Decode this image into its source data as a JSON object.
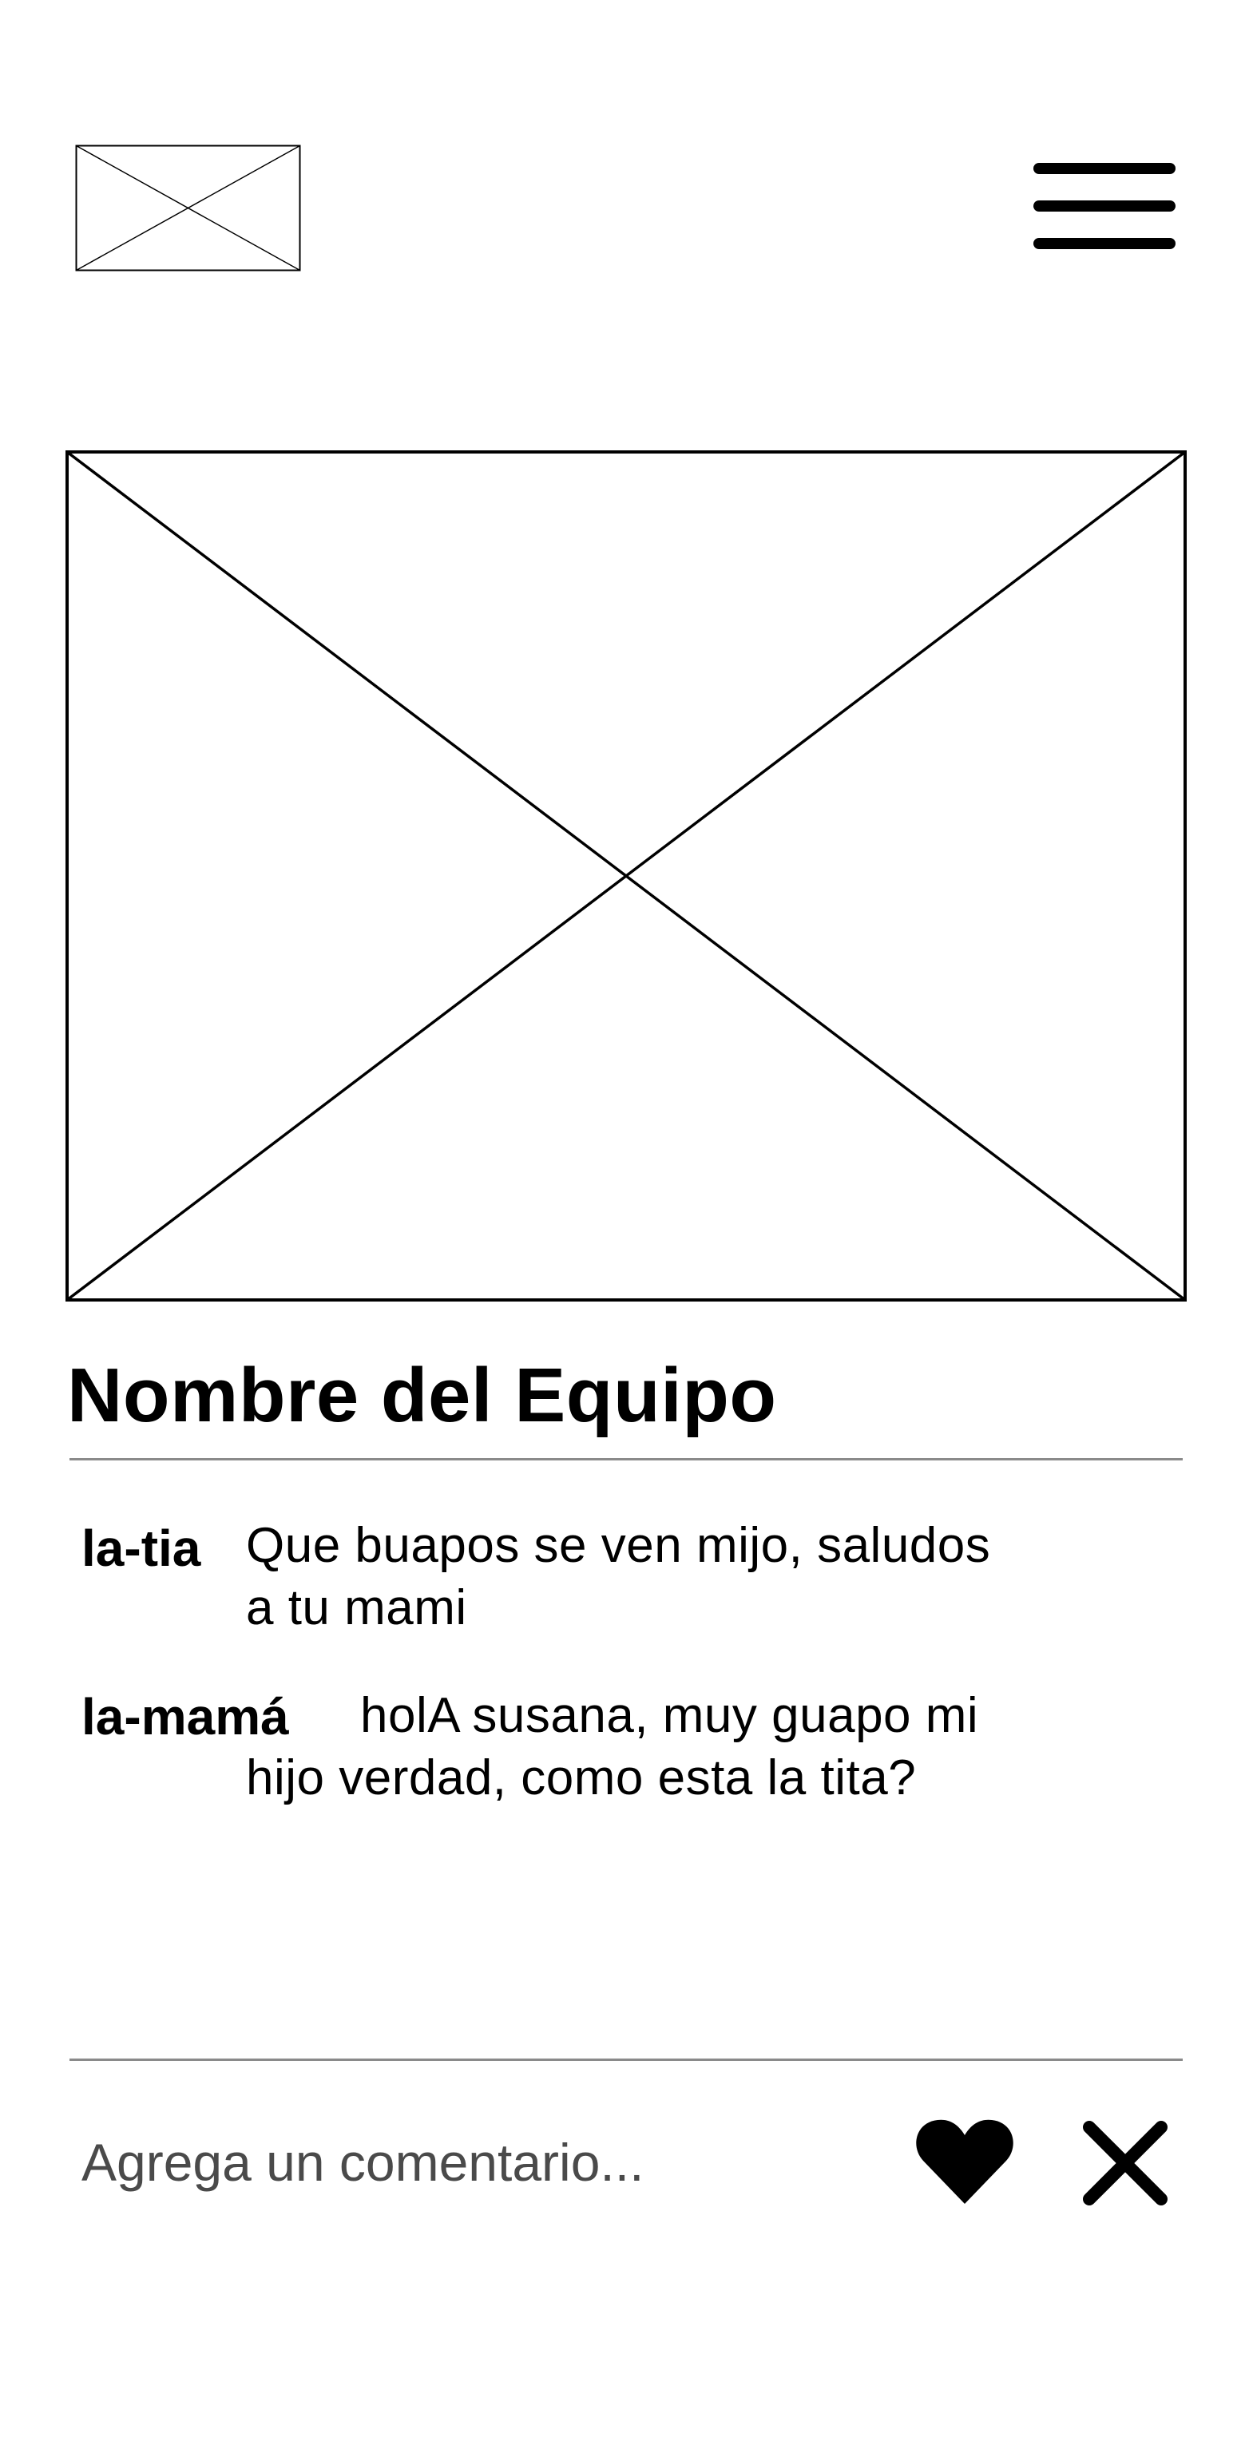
{
  "header": {
    "logo_icon": "image-placeholder-icon",
    "menu_icon": "hamburger-menu-icon"
  },
  "post": {
    "image_icon": "image-placeholder-icon",
    "team_name": "Nombre del Equipo"
  },
  "comments": [
    {
      "author": "la-tia",
      "lines": [
        "Que buapos se ven mijo, saludos",
        "a tu mami"
      ]
    },
    {
      "author": "la-mamá",
      "lines": [
        "holA susana, muy guapo mi",
        "hijo verdad, como esta la tita?"
      ]
    }
  ],
  "comment_bar": {
    "placeholder": "Agrega un comentario...",
    "like_icon": "heart-icon",
    "close_icon": "close-icon"
  },
  "colors": {
    "text": "#000000",
    "divider": "#8a8a8a",
    "placeholder_text": "#4a4a4a",
    "background": "#ffffff"
  }
}
